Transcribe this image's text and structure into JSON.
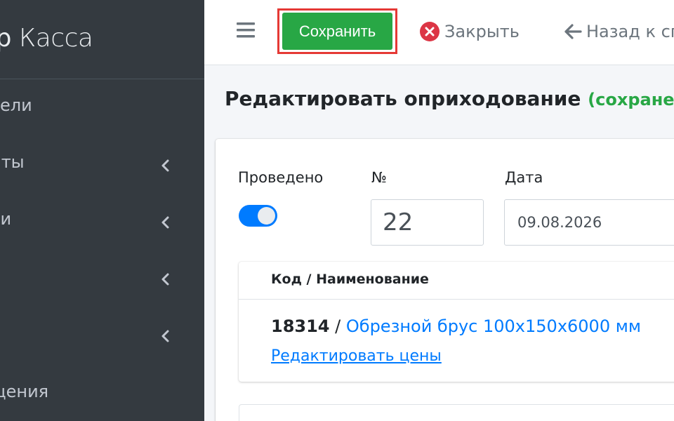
{
  "sidebar": {
    "brand_part1": "ер",
    "brand_part2": "Касса",
    "items": [
      {
        "label": "тели",
        "has_children": false
      },
      {
        "label": "нты",
        "has_children": true
      },
      {
        "label": "ки",
        "has_children": true
      },
      {
        "label": "и",
        "has_children": true
      },
      {
        "label": "",
        "has_children": true
      },
      {
        "label": "щения",
        "has_children": false
      }
    ]
  },
  "navbar": {
    "save_label": "Сохранить",
    "close_label": "Закрыть",
    "back_label": "Назад к сп"
  },
  "page": {
    "title": "Редактировать оприходование",
    "status": "(сохранен"
  },
  "form": {
    "posted_label": "Проведено",
    "posted_value": true,
    "number_label": "№",
    "number_value": "22",
    "date_label": "Дата",
    "date_value": "09.08.2026"
  },
  "items": {
    "header": "Код / Наименование",
    "rows": [
      {
        "code": "18314",
        "separator": "/",
        "name": "Обрезной брус 100х150х6000 мм",
        "edit_link": "Редактировать цены"
      }
    ]
  },
  "colors": {
    "sidebar_bg": "#343a40",
    "save_green": "#28a745",
    "highlight_red": "#e53935",
    "link_blue": "#007bff",
    "close_red": "#dc3545"
  }
}
